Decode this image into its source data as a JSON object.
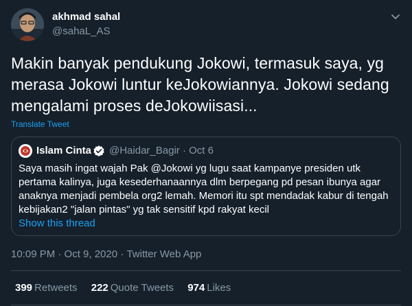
{
  "author": {
    "name": "akhmad sahal",
    "handle": "@sahaL_AS"
  },
  "tweet": {
    "text": "Makin banyak pendukung Jokowi, termasuk saya, yg merasa Jokowi  luntur keJokowiannya. Jokowi sedang mengalami proses deJokowiisasi...",
    "translate_label": "Translate Tweet"
  },
  "quoted": {
    "name": "Islam Cinta",
    "handle_date": "@Haidar_Bagir · Oct 6",
    "text": "Saya masih ingat wajah Pak @Jokowi yg lugu saat  kampanye presiden utk pertama kalinya, juga kesederhanaannya dlm berpegang pd pesan ibunya agar anaknya menjadi pembela org2 lemah. Memori itu spt mendadak kabur di tengah kebijakan2 \"jalan pintas\" yg tak sensitif kpd rakyat kecil",
    "show_thread": "Show this thread"
  },
  "meta": {
    "time_date": "10:09 PM · Oct 9, 2020",
    "separator": " · ",
    "client": "Twitter Web App"
  },
  "stats": {
    "retweets_count": "399",
    "retweets_label": "Retweets",
    "quotes_count": "222",
    "quotes_label": "Quote Tweets",
    "likes_count": "974",
    "likes_label": "Likes"
  },
  "colors": {
    "background": "#15202b",
    "accent": "#1da1f2",
    "secondary_text": "#8899a6",
    "border": "#38444d"
  },
  "icons": {
    "caret": "chevron-down-icon",
    "verified": "verified-badge-icon"
  }
}
